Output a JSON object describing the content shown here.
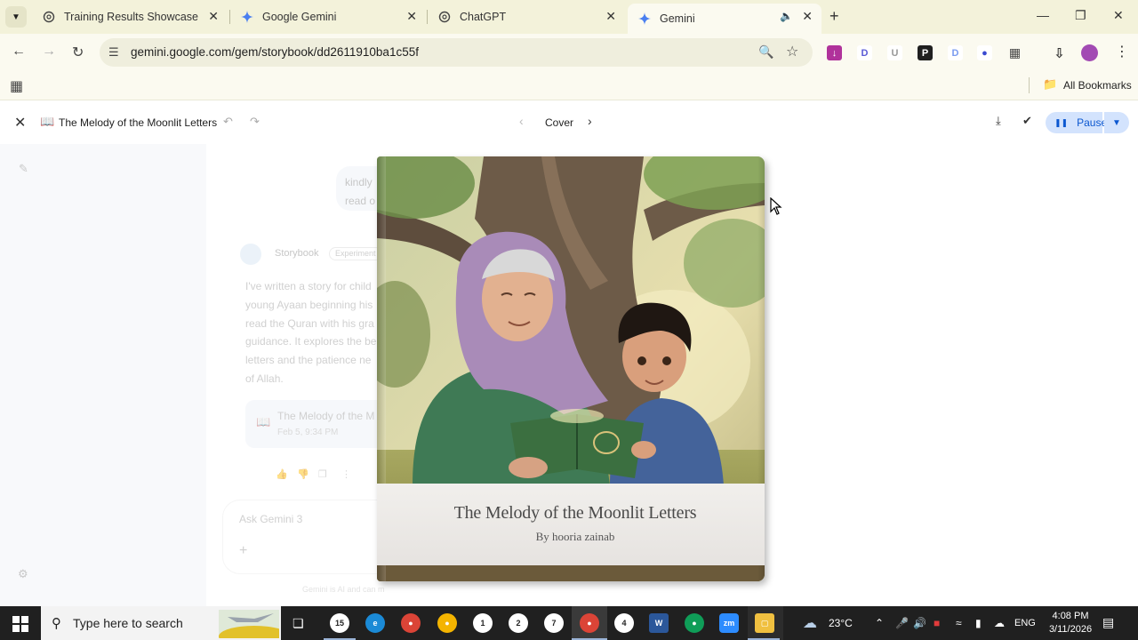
{
  "browser": {
    "tabs": [
      {
        "title": "Training Results Showcase",
        "icon": "openai-icon"
      },
      {
        "title": "Google Gemini",
        "icon": "gemini-icon"
      },
      {
        "title": "ChatGPT",
        "icon": "openai-icon"
      },
      {
        "title": "Gemini",
        "icon": "gemini-icon",
        "active": true,
        "audio": true
      }
    ],
    "url": "gemini.google.com/gem/storybook/dd2611910ba1c55f",
    "bookmarks_label": "All Bookmarks"
  },
  "app": {
    "doc_title": "The Melody of the Moonlit Letters",
    "page_label": "Cover",
    "pause_label": "Pause"
  },
  "chat": {
    "user_message": "kindly ... read o...",
    "user_line1": "kindly",
    "user_line2": "read o",
    "agent_name": "Storybook",
    "agent_badge": "Experiment",
    "intro": "I've written a story for child... young Ayaan beginning his ... read the Quran with his gra... guidance. It explores the be... letters and the patience ne... of Allah.",
    "intro_lines": [
      "I've written a story for child",
      "young Ayaan beginning his",
      "read the Quran with his gra",
      "guidance. It explores the be",
      "letters and the patience ne",
      "of Allah."
    ],
    "card_title": "The Melody of the M",
    "card_date": "Feb 5, 9:34 PM",
    "ask_placeholder": "Ask Gemini 3",
    "disclaimer": "Gemini is AI and can make mistakes."
  },
  "book": {
    "title": "The Melody of the Moonlit Letters",
    "author": "By hooria zainab"
  },
  "taskbar": {
    "search_placeholder": "Type here to search",
    "weather": "23°C",
    "language": "ENG",
    "time": "4:08 PM",
    "date": "3/11/2026",
    "badges": [
      "15",
      "1",
      "2",
      "7",
      "4"
    ]
  },
  "colors": {
    "chrome_bg": "#f3f2da",
    "accent_blue": "#0b57d0",
    "pause_bg": "#d3e3fd"
  }
}
